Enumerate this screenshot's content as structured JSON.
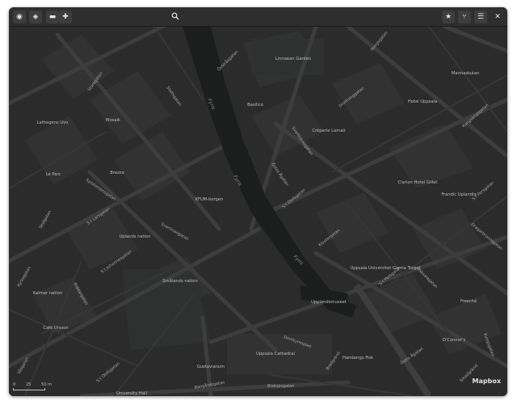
{
  "toolbar": {
    "search": {
      "value": "",
      "placeholder": ""
    }
  },
  "map": {
    "attribution": "Mapbox",
    "scale": [
      "0",
      "25",
      "50 m"
    ],
    "water_labels": [
      "Fyris",
      "Fyris",
      "Fyris"
    ],
    "poi_labels": {
      "linnaeus_garden": "Linnaean Garden",
      "basilico": "Basilico",
      "hotel_uppsala": "Hotel Uppsala",
      "mannaskulan": "Mannaskulan",
      "lathagens": "Lathagens Uvo",
      "mosaik": "Mosaik",
      "crepes": "Crêperie Lamaô",
      "brezza": "Brezza",
      "le_parc": "Le Parc",
      "kfum": "KFUM-borgen",
      "clarion": "Clarion Hotel Gillet",
      "frandic": "Frandic Uplandia",
      "uplands_nation": "Uplands nation",
      "smalands_nation": "Smålands nation",
      "kalmar_nation": "Kalmar nation",
      "uppsala_univ": "Uppsala Universitet Gamla Torget",
      "upplandsmuseet": "Upplandsmuseet",
      "freeche": "Freeché",
      "cafe_ursson": "Café Ursson",
      "uppsala_cathedral": "Uppsala Cathedral",
      "hamberg": "Hambergs Fisk",
      "oconnors": "O'Connor's",
      "gustavianum": "Gustavianum",
      "university_hall": "University Hall"
    },
    "street_labels": {
      "sturegatan": "Sturegatan",
      "slottsgatan": "Slottsgatan",
      "drottninggatan_top": "Drottninggatan",
      "kungsgatan": "Kungsgatan",
      "osterasgatan": "Österåsgatan",
      "kungsangsgatan": "Kungsängsgatan",
      "svartbackasgatan": "Svartbäcksgatan",
      "s_olofsgatan": "S:t Olofsgatan",
      "ostra_agatan": "Östra Ågatan",
      "s_persgatan_right": "S:t Persgatan",
      "dragarbrunnsgatan": "Dragarbrunnsgatan",
      "sysslomansgatan": "Sysslomansgatan",
      "s_larsgatan": "S:t Larsgatan",
      "s_johannesgatan": "S:t Johannesgatan",
      "skolgatan": "Skolgatan",
      "svartmangatan": "Svartmangatan",
      "riddargatan": "Riddargatan",
      "kyrkogatan": "Kyrkogatan",
      "s_persgatan_mid": "S:t Persgatan",
      "klostergatan": "Klostergatan",
      "domkyrkoplan": "Domkyrkoplan",
      "vaksalagatan": "Vaksalagatan",
      "s_olofsgatan_bottom": "S:t Olofsgatan",
      "bredgrand": "Bredgränd",
      "ostra_agatan_bottom": "Östra Ågatan",
      "smedgrand": "Smedgränd",
      "kungsgatan_right": "Kungsgatan",
      "biskopsgatan": "Biskopsgatan",
      "bangardsgatan": "Bangårdsgatan",
      "valsgatan": "Väsgatan"
    }
  },
  "colors": {
    "window_bg": "#2b2b2b",
    "road": "#3c3c3c",
    "block": "#323232",
    "water": "#1b1d1d",
    "park": "#2e3030"
  }
}
